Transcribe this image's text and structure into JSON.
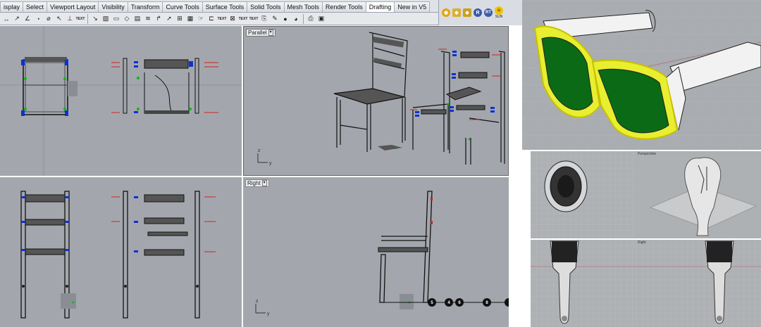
{
  "tabs": [
    "isplay",
    "Select",
    "Viewport Layout",
    "Visibility",
    "Transform",
    "Curve Tools",
    "Surface Tools",
    "Solid Tools",
    "Mesh Tools",
    "Render Tools",
    "Drafting",
    "New in V5"
  ],
  "active_tab": 10,
  "toolbar_text_icons": [
    "TEXT",
    "TEXT",
    "TEXT",
    "TEXT"
  ],
  "right_toolbar": {
    "sun_label": "SUN"
  },
  "viewports": {
    "perspective": {
      "label": "Parallel"
    },
    "right": {
      "label": "Right"
    }
  },
  "dimension_markers": [
    "5",
    "4",
    "6",
    "8"
  ],
  "render_thumbs": {
    "perspective_label": "Perspective",
    "right_label": "Right"
  },
  "colors": {
    "viewport_bg": "#a3a7ad",
    "accent_yellow": "#e8e800",
    "lens_green": "#0b6a16"
  }
}
